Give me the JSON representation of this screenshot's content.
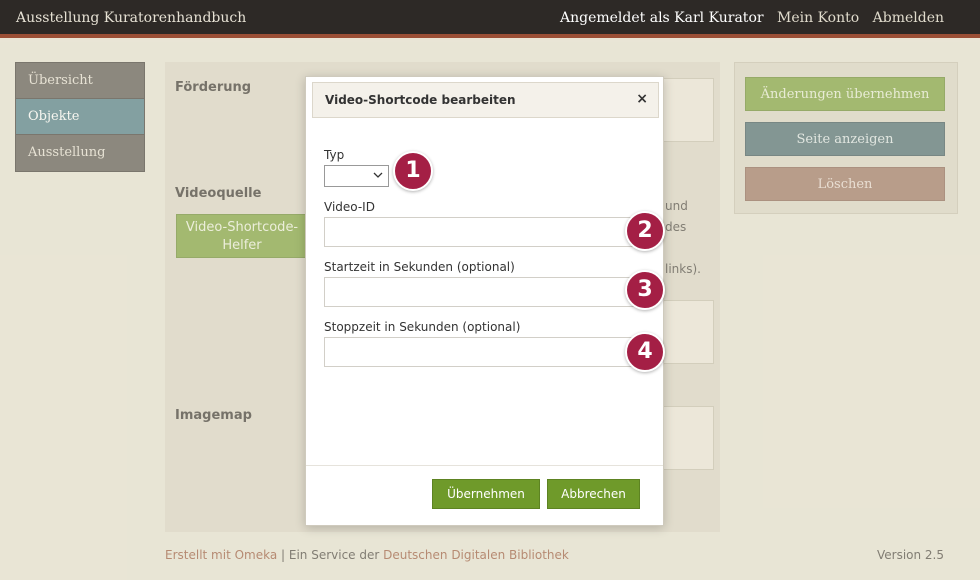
{
  "topbar": {
    "site_title": "Ausstellung Kuratorenhandbuch",
    "logged_in": "Angemeldet als Karl Kurator",
    "account": "Mein Konto",
    "logout": "Abmelden"
  },
  "nav": {
    "items": [
      {
        "label": "Übersicht"
      },
      {
        "label": "Objekte"
      },
      {
        "label": "Ausstellung"
      }
    ]
  },
  "main": {
    "funding_label": "Förderung",
    "video_source_label": "Videoquelle",
    "helper_button": "Video-Shortcode-Helfer",
    "info_lines": [
      "und",
      "des",
      "links)."
    ],
    "imagemap_label": "Imagemap"
  },
  "actions": {
    "save": "Änderungen übernehmen",
    "view": "Seite anzeigen",
    "delete": "Löschen"
  },
  "modal": {
    "title": "Video-Shortcode bearbeiten",
    "close_icon": "×",
    "type_label": "Typ",
    "type_value": "",
    "video_id_label": "Video-ID",
    "video_id_value": "",
    "start_label": "Startzeit in Sekunden (optional)",
    "start_value": "",
    "stop_label": "Stoppzeit in Sekunden (optional)",
    "stop_value": "",
    "apply": "Übernehmen",
    "cancel": "Abbrechen"
  },
  "callouts": [
    "1",
    "2",
    "3",
    "4"
  ],
  "footer": {
    "created_with": "Erstellt mit Omeka",
    "separator": " | Ein Service der ",
    "ddb": "Deutschen Digitalen Bibliothek",
    "version": "Version 2.5"
  },
  "colors": {
    "accent_green": "#7fa23b",
    "callout": "#a41f45",
    "header": "#2d2926",
    "active_nav": "#4d7c86"
  }
}
